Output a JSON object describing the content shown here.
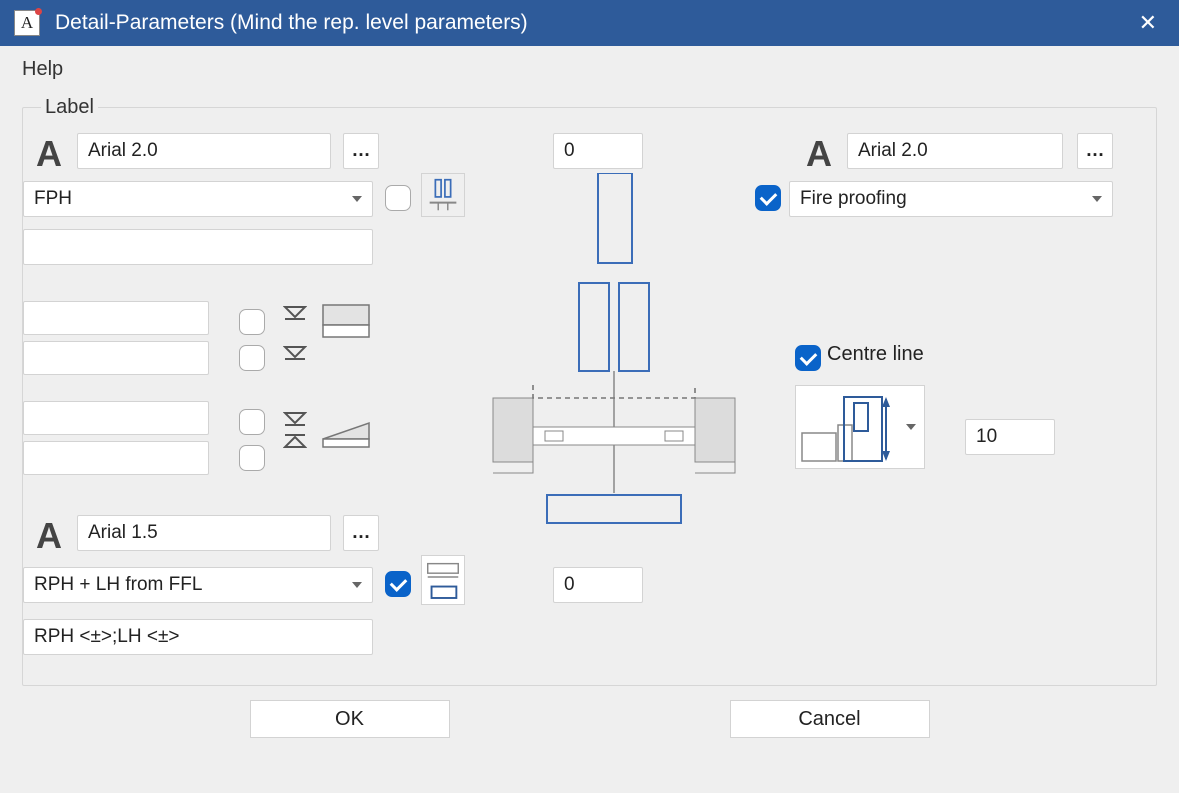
{
  "window": {
    "title": "Detail-Parameters (Mind the rep. level parameters)",
    "close_icon": "✕"
  },
  "menubar": {
    "help": "Help"
  },
  "group": {
    "legend": "Label"
  },
  "left": {
    "big_a1": "A",
    "font1": "Arial 2.0",
    "ellipsis1": "…",
    "dropdown1": "FPH",
    "big_a2": "A",
    "font2": "Arial 1.5",
    "ellipsis2": "…",
    "dropdown2": "RPH + LH from FFL",
    "bottom_text": "RPH <±>;LH <±>"
  },
  "center": {
    "top_value": "0",
    "bottom_value": "0"
  },
  "right": {
    "big_a": "A",
    "font": "Arial 2.0",
    "ellipsis": "…",
    "dropdown": "Fire proofing",
    "centre_line": "Centre line",
    "number": "10"
  },
  "buttons": {
    "ok": "OK",
    "cancel": "Cancel"
  }
}
